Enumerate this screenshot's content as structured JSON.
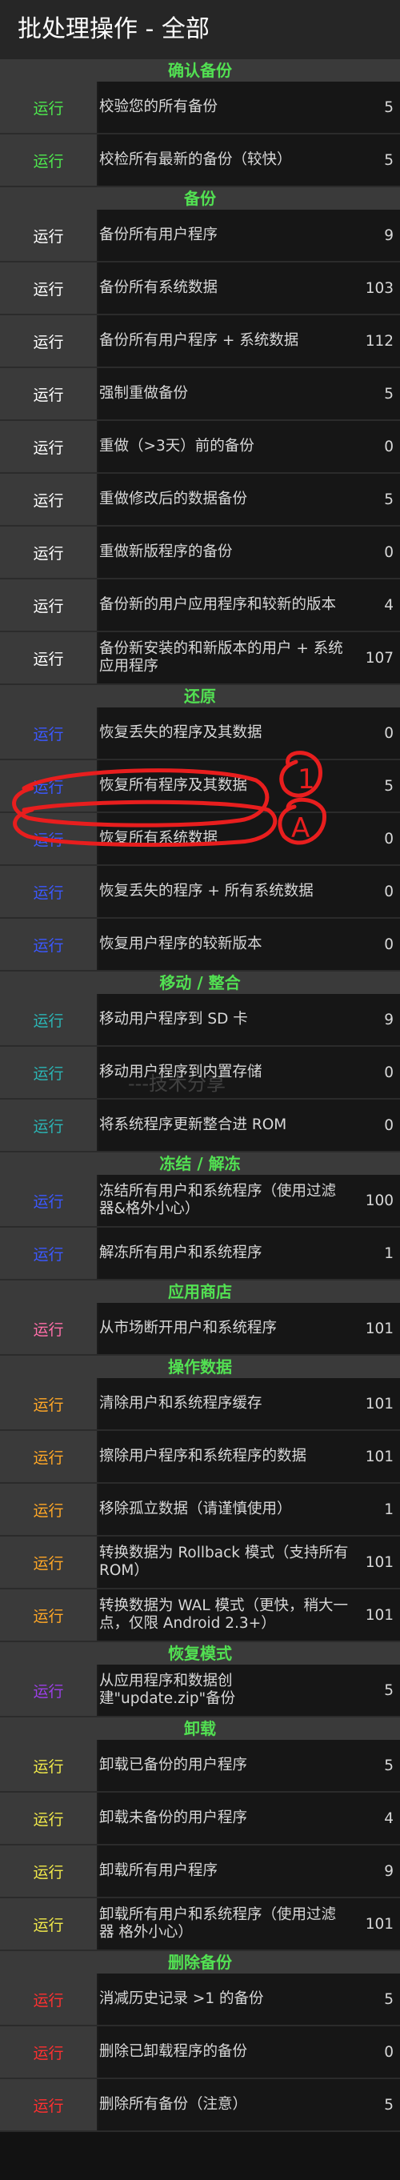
{
  "title": "批处理操作 - 全部",
  "colors": {
    "section_header": "#52e052",
    "run_verify": "#4ee84e",
    "run_backup": "#ffffff",
    "run_restore": "#3b58ff",
    "run_move": "#2bb5b5",
    "run_freeze": "#3b58ff",
    "run_market": "#ff6ea8",
    "run_data": "#ffa726",
    "run_recovery": "#9c3fe8",
    "run_uninstall": "#f0e84a",
    "run_delete": "#ff3030",
    "annotation": "#e81e1e"
  },
  "sections": [
    {
      "title": "确认备份",
      "run_color": "#4ee84e",
      "items": [
        {
          "run": "运行",
          "label": "校验您的所有备份",
          "count": "5"
        },
        {
          "run": "运行",
          "label": "校检所有最新的备份（较快）",
          "count": "5"
        }
      ]
    },
    {
      "title": "备份",
      "run_color": "#ffffff",
      "items": [
        {
          "run": "运行",
          "label": "备份所有用户程序",
          "count": "9"
        },
        {
          "run": "运行",
          "label": "备份所有系统数据",
          "count": "103"
        },
        {
          "run": "运行",
          "label": "备份所有用户程序 + 系统数据",
          "count": "112"
        },
        {
          "run": "运行",
          "label": "强制重做备份",
          "count": "5"
        },
        {
          "run": "运行",
          "label": "重做（>3天）前的备份",
          "count": "0"
        },
        {
          "run": "运行",
          "label": "重做修改后的数据备份",
          "count": "5"
        },
        {
          "run": "运行",
          "label": "重做新版程序的备份",
          "count": "0"
        },
        {
          "run": "运行",
          "label": "备份新的用户应用程序和较新的版本",
          "count": "4"
        },
        {
          "run": "运行",
          "label": "备份新安装的和新版本的用户 + 系统应用程序",
          "count": "107"
        }
      ]
    },
    {
      "title": "还原",
      "run_color": "#3b58ff",
      "items": [
        {
          "run": "运行",
          "label": "恢复丢失的程序及其数据",
          "count": "0"
        },
        {
          "run": "运行",
          "label": "恢复所有程序及其数据",
          "count": "5"
        },
        {
          "run": "运行",
          "label": "恢复所有系统数据",
          "count": "0"
        },
        {
          "run": "运行",
          "label": "恢复丢失的程序 + 所有系统数据",
          "count": "0"
        },
        {
          "run": "运行",
          "label": "恢复用户程序的较新版本",
          "count": "0"
        }
      ]
    },
    {
      "title": "移动 / 整合",
      "run_color": "#2bb5b5",
      "items": [
        {
          "run": "运行",
          "label": "移动用户程序到 SD 卡",
          "count": "9"
        },
        {
          "run": "运行",
          "label": "移动用户程序到内置存储",
          "count": "0"
        },
        {
          "run": "运行",
          "label": "将系统程序更新整合进 ROM",
          "count": "0"
        }
      ]
    },
    {
      "title": "冻结 / 解冻",
      "run_color": "#3b58ff",
      "items": [
        {
          "run": "运行",
          "label": "冻结所有用户和系统程序（使用过滤器&格外小心）",
          "count": "100"
        },
        {
          "run": "运行",
          "label": "解冻所有用户和系统程序",
          "count": "1"
        }
      ]
    },
    {
      "title": "应用商店",
      "run_color": "#ff6ea8",
      "items": [
        {
          "run": "运行",
          "label": "从市场断开用户和系统程序",
          "count": "101"
        }
      ]
    },
    {
      "title": "操作数据",
      "run_color": "#ffa726",
      "items": [
        {
          "run": "运行",
          "label": "清除用户和系统程序缓存",
          "count": "101"
        },
        {
          "run": "运行",
          "label": "擦除用户程序和系统程序的数据",
          "count": "101"
        },
        {
          "run": "运行",
          "label": "移除孤立数据（请谨慎使用）",
          "count": "1"
        },
        {
          "run": "运行",
          "label": "转换数据为 Rollback 模式（支持所有 ROM）",
          "count": "101"
        },
        {
          "run": "运行",
          "label": "转换数据为 WAL 模式（更快，稍大一点，仅限 Android 2.3+）",
          "count": "101"
        }
      ]
    },
    {
      "title": "恢复模式",
      "run_color": "#9c3fe8",
      "items": [
        {
          "run": "运行",
          "label": "从应用程序和数据创建\"update.zip\"备份",
          "count": "5"
        }
      ]
    },
    {
      "title": "卸载",
      "run_color": "#f0e84a",
      "items": [
        {
          "run": "运行",
          "label": "卸载已备份的用户程序",
          "count": "5"
        },
        {
          "run": "运行",
          "label": "卸载未备份的用户程序",
          "count": "4"
        },
        {
          "run": "运行",
          "label": "卸载所有用户程序",
          "count": "9"
        },
        {
          "run": "运行",
          "label": "卸载所有用户和系统程序（使用过滤器 格外小心）",
          "count": "101"
        }
      ]
    },
    {
      "title": "删除备份",
      "run_color": "#ff3030",
      "items": [
        {
          "run": "运行",
          "label": "消减历史记录 >1 的备份",
          "count": "5"
        },
        {
          "run": "运行",
          "label": "删除已卸载程序的备份",
          "count": "0"
        },
        {
          "run": "运行",
          "label": "删除所有备份（注意）",
          "count": "5"
        }
      ]
    }
  ],
  "annotations": [
    {
      "text": "1"
    },
    {
      "text": "A"
    }
  ],
  "watermark": "---技术分享"
}
